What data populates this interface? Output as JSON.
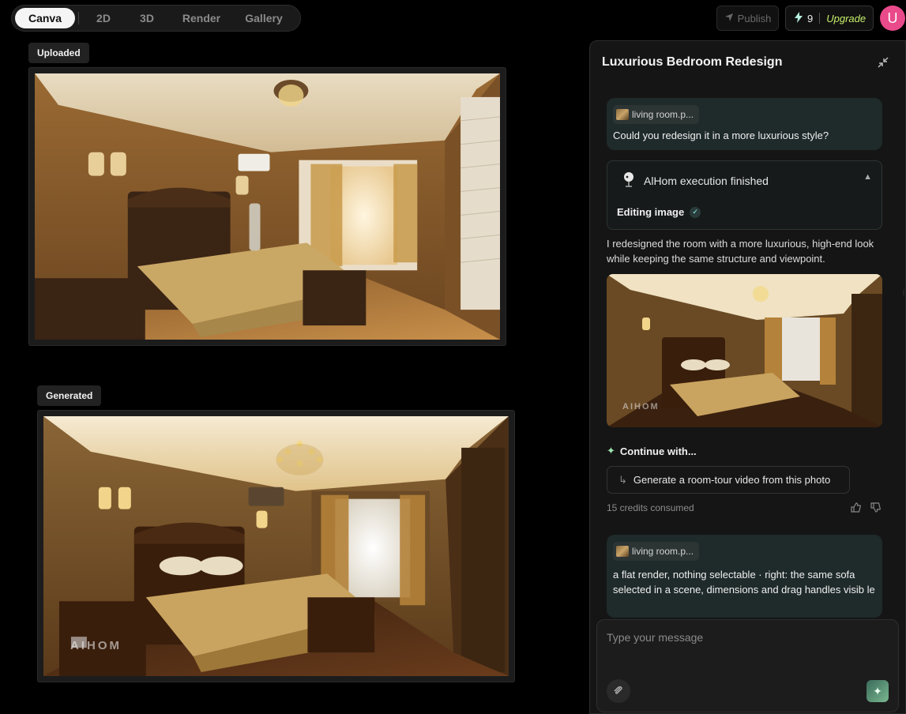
{
  "tabs": [
    {
      "label": "Canva",
      "active": true
    },
    {
      "label": "2D",
      "active": false
    },
    {
      "label": "3D",
      "active": false
    },
    {
      "label": "Render",
      "active": false
    },
    {
      "label": "Gallery",
      "active": false
    }
  ],
  "topbar": {
    "publish_label": "Publish",
    "credits": "9",
    "upgrade_label": "Upgrade",
    "avatar_initial": "U"
  },
  "canvas": {
    "uploaded_label": "Uploaded",
    "generated_label": "Generated",
    "watermark": "AIHOM"
  },
  "chat": {
    "title": "Luxurious Bedroom Redesign",
    "messages": [
      {
        "file": "living room.p...",
        "text": "Could you redesign it in a more luxurious style?"
      },
      {
        "file": "living room.p...",
        "text": "a flat render, nothing selectable · right: the same sofa selected in a scene, dimensions and drag handles visib le"
      }
    ],
    "execution": {
      "title": "AlHom execution finished",
      "step": "Editing image"
    },
    "reply": "I redesigned the room with a more luxurious, high-end look while keeping the same structure and viewpoint.",
    "continue_label": "Continue with...",
    "suggestion": "Generate a room-tour video from this photo",
    "credits_consumed": "15 credits consumed",
    "input_placeholder": "Type your message"
  },
  "colors": {
    "accent_upgrade": "#c8f06a",
    "avatar": "#e94a8a",
    "bubble": "#1f2a2a"
  }
}
